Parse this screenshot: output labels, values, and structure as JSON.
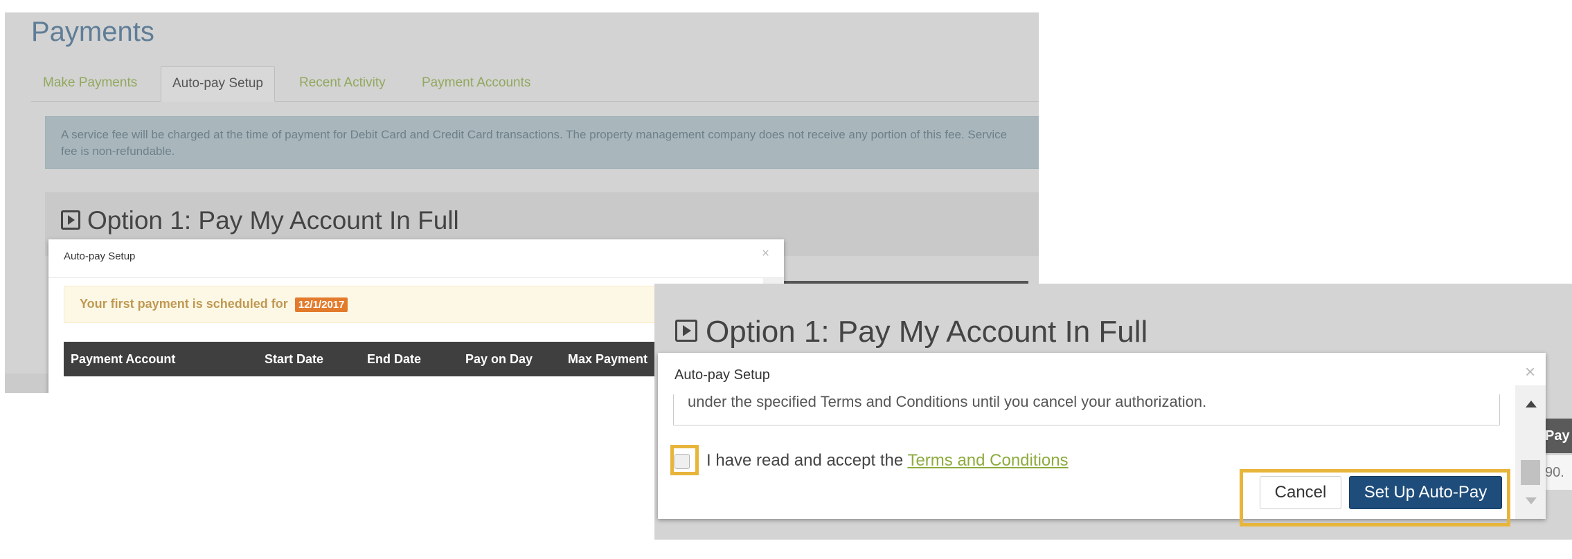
{
  "page": {
    "title": "Payments"
  },
  "tabs": [
    {
      "label": "Make Payments"
    },
    {
      "label": "Auto-pay Setup"
    },
    {
      "label": "Recent Activity"
    },
    {
      "label": "Payment Accounts"
    }
  ],
  "notice": {
    "text": "A service fee will be charged at the time of payment for Debit Card and Credit Card transactions. The property management company does not receive any portion of this fee. Service fee is non-refundable."
  },
  "option1": {
    "title": "Option 1: Pay My Account In Full"
  },
  "modal1": {
    "title": "Auto-pay Setup",
    "close": "×",
    "alert_text": "Your first payment is scheduled for",
    "alert_date": "12/1/2017",
    "columns": [
      "Payment Account",
      "Start Date",
      "End Date",
      "Pay on Day",
      "Max Payment"
    ]
  },
  "zoom": {
    "option_title": "Option 1: Pay My Account In Full",
    "modal_title": "Auto-pay Setup",
    "close": "×",
    "terms_text_partial": "under the specified Terms and Conditions until you cancel your authorization.",
    "accept_prefix": "I have read and accept the",
    "terms_link": "Terms and Conditions",
    "cancel_label": "Cancel",
    "setup_label": "Set Up Auto-Pay",
    "right_header_partial": "Pay",
    "right_value_partial": "90."
  },
  "colors": {
    "highlight": "#e8b53b",
    "primary_button": "#1e4d7b",
    "link_green": "#8dab3d",
    "date_badge": "#e37b2d",
    "page_title": "#5f7d97"
  }
}
